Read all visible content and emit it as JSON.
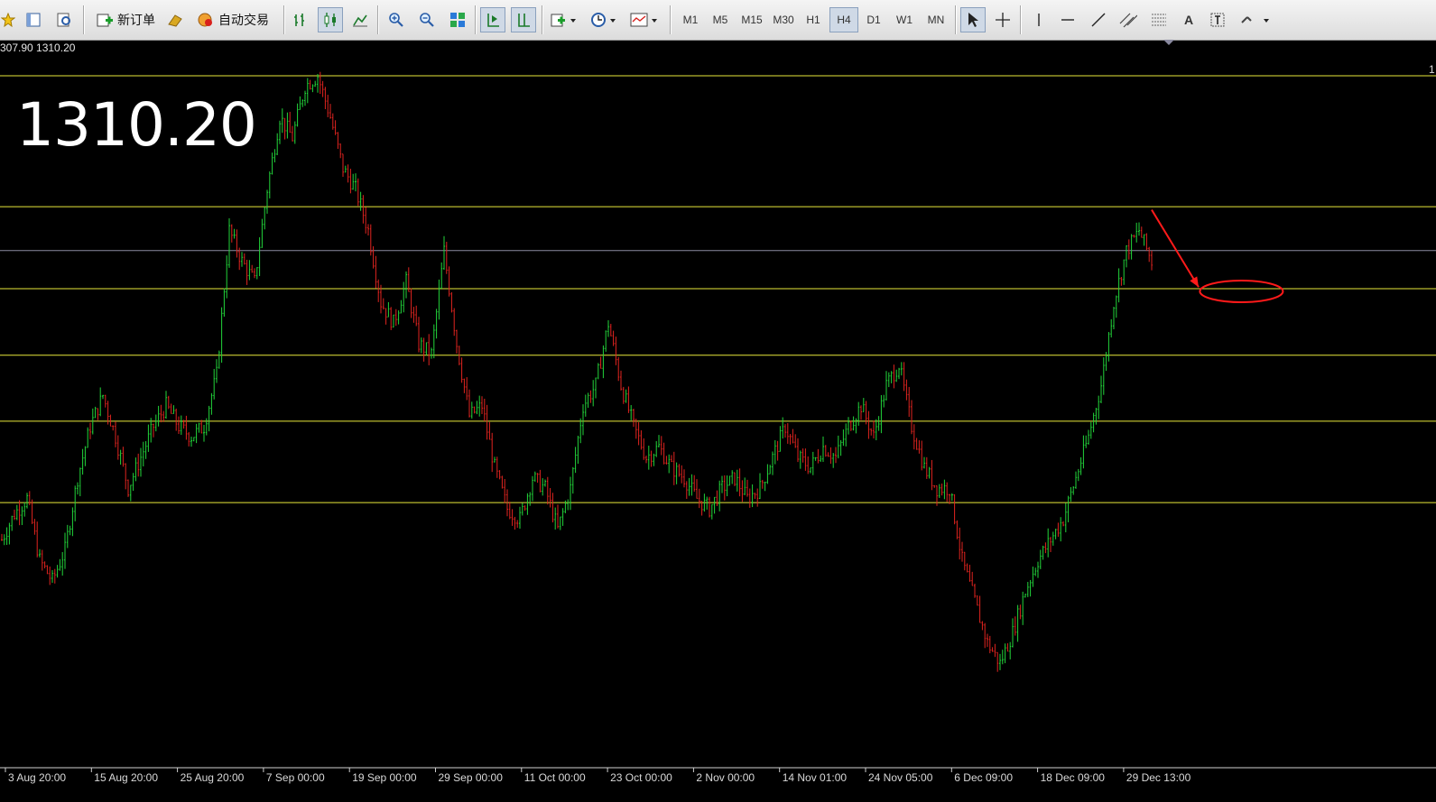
{
  "toolbar": {
    "new_order": "新订单",
    "auto_trading": "自动交易",
    "timeframes": [
      "M1",
      "M5",
      "M15",
      "M30",
      "H1",
      "H4",
      "D1",
      "W1",
      "MN"
    ],
    "selected_timeframe": "H4"
  },
  "price_info": "307.90 1310.20",
  "big_price": "1310.20",
  "colors": {
    "bull": "#22d43a",
    "bear": "#e0241f",
    "level": "#e8e83a",
    "mid_line": "#8a8aa0",
    "annotation": "#ff1a1a",
    "background": "#000000"
  },
  "chart_data": {
    "type": "candlestick",
    "instrument_price_label": "1310.20",
    "x_tick_labels": [
      "3 Aug 20:00",
      "15 Aug 20:00",
      "25 Aug 20:00",
      "7 Sep 00:00",
      "19 Sep 00:00",
      "29 Sep 00:00",
      "11 Oct 00:00",
      "23 Oct 00:00",
      "2 Nov 00:00",
      "14 Nov 01:00",
      "24 Nov 05:00",
      "6 Dec 09:00",
      "18 Dec 09:00",
      "29 Dec 13:00"
    ],
    "price_path": [
      [
        0,
        1240
      ],
      [
        5,
        1245
      ],
      [
        10,
        1248
      ],
      [
        15,
        1236
      ],
      [
        20,
        1232
      ],
      [
        25,
        1238
      ],
      [
        30,
        1252
      ],
      [
        35,
        1262
      ],
      [
        40,
        1268
      ],
      [
        45,
        1260
      ],
      [
        50,
        1250
      ],
      [
        55,
        1256
      ],
      [
        60,
        1262
      ],
      [
        65,
        1266
      ],
      [
        70,
        1262
      ],
      [
        75,
        1260
      ],
      [
        80,
        1262
      ],
      [
        85,
        1272
      ],
      [
        90,
        1300
      ],
      [
        95,
        1294
      ],
      [
        100,
        1290
      ],
      [
        105,
        1308
      ],
      [
        110,
        1322
      ],
      [
        115,
        1318
      ],
      [
        120,
        1328
      ],
      [
        125,
        1330
      ],
      [
        130,
        1322
      ],
      [
        135,
        1312
      ],
      [
        140,
        1308
      ],
      [
        145,
        1300
      ],
      [
        150,
        1286
      ],
      [
        155,
        1282
      ],
      [
        160,
        1290
      ],
      [
        165,
        1278
      ],
      [
        170,
        1276
      ],
      [
        175,
        1296
      ],
      [
        180,
        1278
      ],
      [
        185,
        1264
      ],
      [
        190,
        1266
      ],
      [
        195,
        1254
      ],
      [
        200,
        1246
      ],
      [
        205,
        1244
      ],
      [
        210,
        1252
      ],
      [
        215,
        1250
      ],
      [
        220,
        1242
      ],
      [
        225,
        1250
      ],
      [
        230,
        1266
      ],
      [
        235,
        1270
      ],
      [
        240,
        1282
      ],
      [
        245,
        1270
      ],
      [
        250,
        1262
      ],
      [
        255,
        1256
      ],
      [
        260,
        1258
      ],
      [
        265,
        1254
      ],
      [
        270,
        1252
      ],
      [
        275,
        1248
      ],
      [
        280,
        1246
      ],
      [
        285,
        1250
      ],
      [
        290,
        1252
      ],
      [
        295,
        1248
      ],
      [
        300,
        1250
      ],
      [
        305,
        1256
      ],
      [
        310,
        1262
      ],
      [
        315,
        1256
      ],
      [
        320,
        1254
      ],
      [
        325,
        1258
      ],
      [
        330,
        1256
      ],
      [
        335,
        1262
      ],
      [
        340,
        1266
      ],
      [
        345,
        1260
      ],
      [
        350,
        1270
      ],
      [
        355,
        1274
      ],
      [
        360,
        1262
      ],
      [
        365,
        1254
      ],
      [
        370,
        1250
      ],
      [
        375,
        1250
      ],
      [
        380,
        1236
      ],
      [
        385,
        1228
      ],
      [
        390,
        1220
      ],
      [
        395,
        1216
      ],
      [
        400,
        1222
      ],
      [
        405,
        1230
      ],
      [
        410,
        1236
      ],
      [
        415,
        1240
      ],
      [
        420,
        1244
      ],
      [
        425,
        1252
      ],
      [
        430,
        1260
      ],
      [
        435,
        1270
      ],
      [
        440,
        1286
      ],
      [
        445,
        1296
      ],
      [
        450,
        1300
      ],
      [
        455,
        1294
      ]
    ],
    "candle_count": 456,
    "y_range": [
      1197,
      1337
    ],
    "horizontal_levels": [
      {
        "price": 1330.0,
        "color": "#e8e83a",
        "right_label": "1"
      },
      {
        "price": 1304.6,
        "color": "#e8e83a"
      },
      {
        "price": 1296.1,
        "color": "#8a8aa0"
      },
      {
        "price": 1288.7,
        "color": "#e8e83a"
      },
      {
        "price": 1275.8,
        "color": "#e8e83a"
      },
      {
        "price": 1263.0,
        "color": "#e8e83a"
      },
      {
        "price": 1247.2,
        "color": "#e8e83a"
      }
    ],
    "annotations": [
      {
        "type": "arrow",
        "from": [
          455,
          1304
        ],
        "to": [
          470,
          1289
        ]
      },
      {
        "type": "ellipse",
        "center": [
          478,
          1288.7
        ]
      }
    ],
    "grid": false,
    "legend": "none"
  }
}
